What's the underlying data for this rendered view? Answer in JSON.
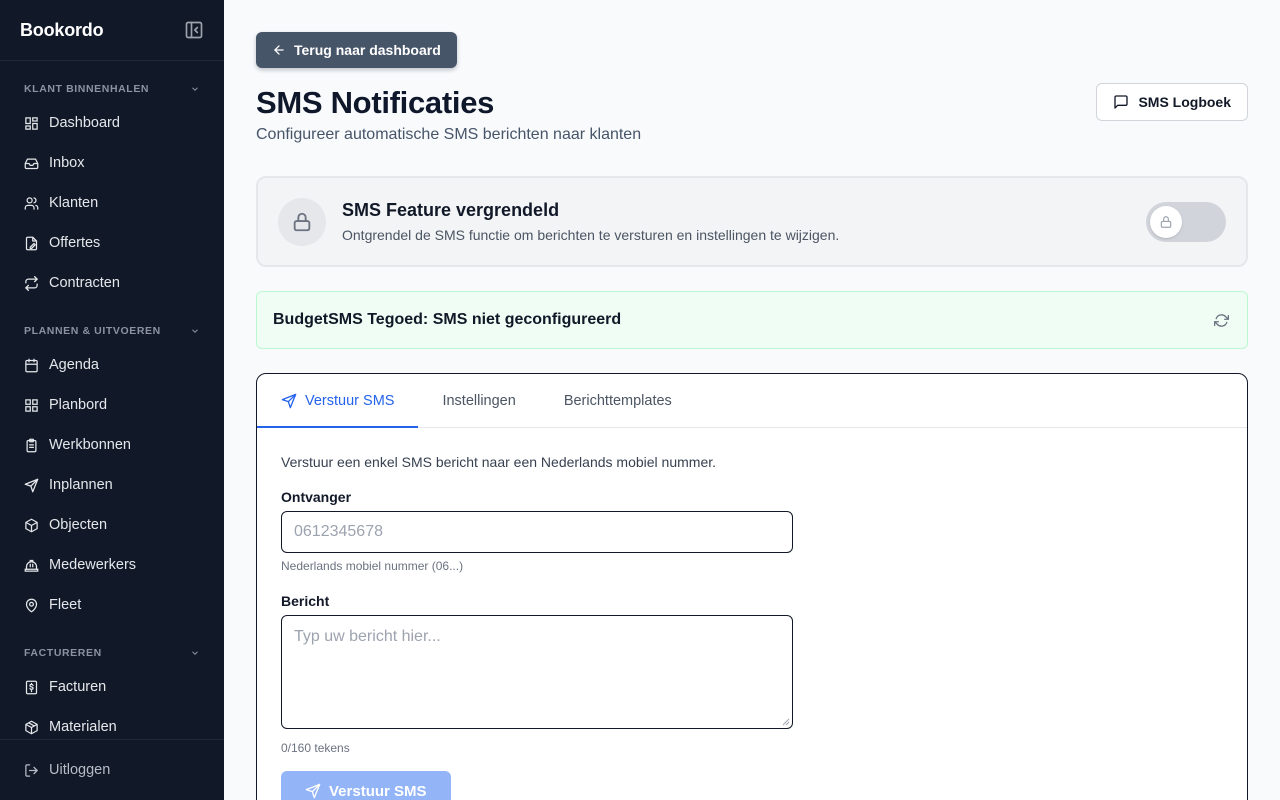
{
  "app": {
    "brand": "Bookordo"
  },
  "sidebar": {
    "sections": [
      {
        "title": "KLANT BINNENHALEN",
        "items": [
          {
            "label": "Dashboard",
            "icon": "dashboard-icon"
          },
          {
            "label": "Inbox",
            "icon": "inbox-icon"
          },
          {
            "label": "Klanten",
            "icon": "users-icon"
          },
          {
            "label": "Offertes",
            "icon": "file-edit-icon"
          },
          {
            "label": "Contracten",
            "icon": "repeat-icon"
          }
        ]
      },
      {
        "title": "PLANNEN & UITVOEREN",
        "items": [
          {
            "label": "Agenda",
            "icon": "calendar-icon"
          },
          {
            "label": "Planbord",
            "icon": "grid-icon"
          },
          {
            "label": "Werkbonnen",
            "icon": "clipboard-icon"
          },
          {
            "label": "Inplannen",
            "icon": "send-icon"
          },
          {
            "label": "Objecten",
            "icon": "box-icon"
          },
          {
            "label": "Medewerkers",
            "icon": "hardhat-icon"
          },
          {
            "label": "Fleet",
            "icon": "map-pin-icon"
          }
        ]
      },
      {
        "title": "FACTUREREN",
        "items": [
          {
            "label": "Facturen",
            "icon": "invoice-icon"
          },
          {
            "label": "Materialen",
            "icon": "package-icon"
          }
        ]
      }
    ],
    "logout_label": "Uitloggen"
  },
  "header": {
    "back_label": "Terug naar dashboard",
    "title": "SMS Notificaties",
    "subtitle": "Configureer automatische SMS berichten naar klanten",
    "logbook_label": "SMS Logboek"
  },
  "lock_card": {
    "title": "SMS Feature vergrendeld",
    "description": "Ontgrendel de SMS functie om berichten te versturen en instellingen te wijzigen.",
    "toggle_on": false
  },
  "balance": {
    "text": "BudgetSMS Tegoed: SMS niet geconfigureerd"
  },
  "tabs": [
    {
      "label": "Verstuur SMS",
      "active": true
    },
    {
      "label": "Instellingen",
      "active": false
    },
    {
      "label": "Berichttemplates",
      "active": false
    }
  ],
  "form": {
    "intro": "Verstuur een enkel SMS bericht naar een Nederlands mobiel nummer.",
    "recipient_label": "Ontvanger",
    "recipient_placeholder": "0612345678",
    "recipient_value": "",
    "recipient_hint": "Nederlands mobiel nummer (06...)",
    "message_label": "Bericht",
    "message_placeholder": "Typ uw bericht hier...",
    "message_value": "",
    "counter": "0/160 tekens",
    "send_label": "Verstuur SMS"
  },
  "colors": {
    "sidebar_bg": "#111827",
    "accent": "#2563eb",
    "success_bg": "#f0fdf4",
    "button_dark": "#475569",
    "button_disabled": "#93b4f6"
  }
}
